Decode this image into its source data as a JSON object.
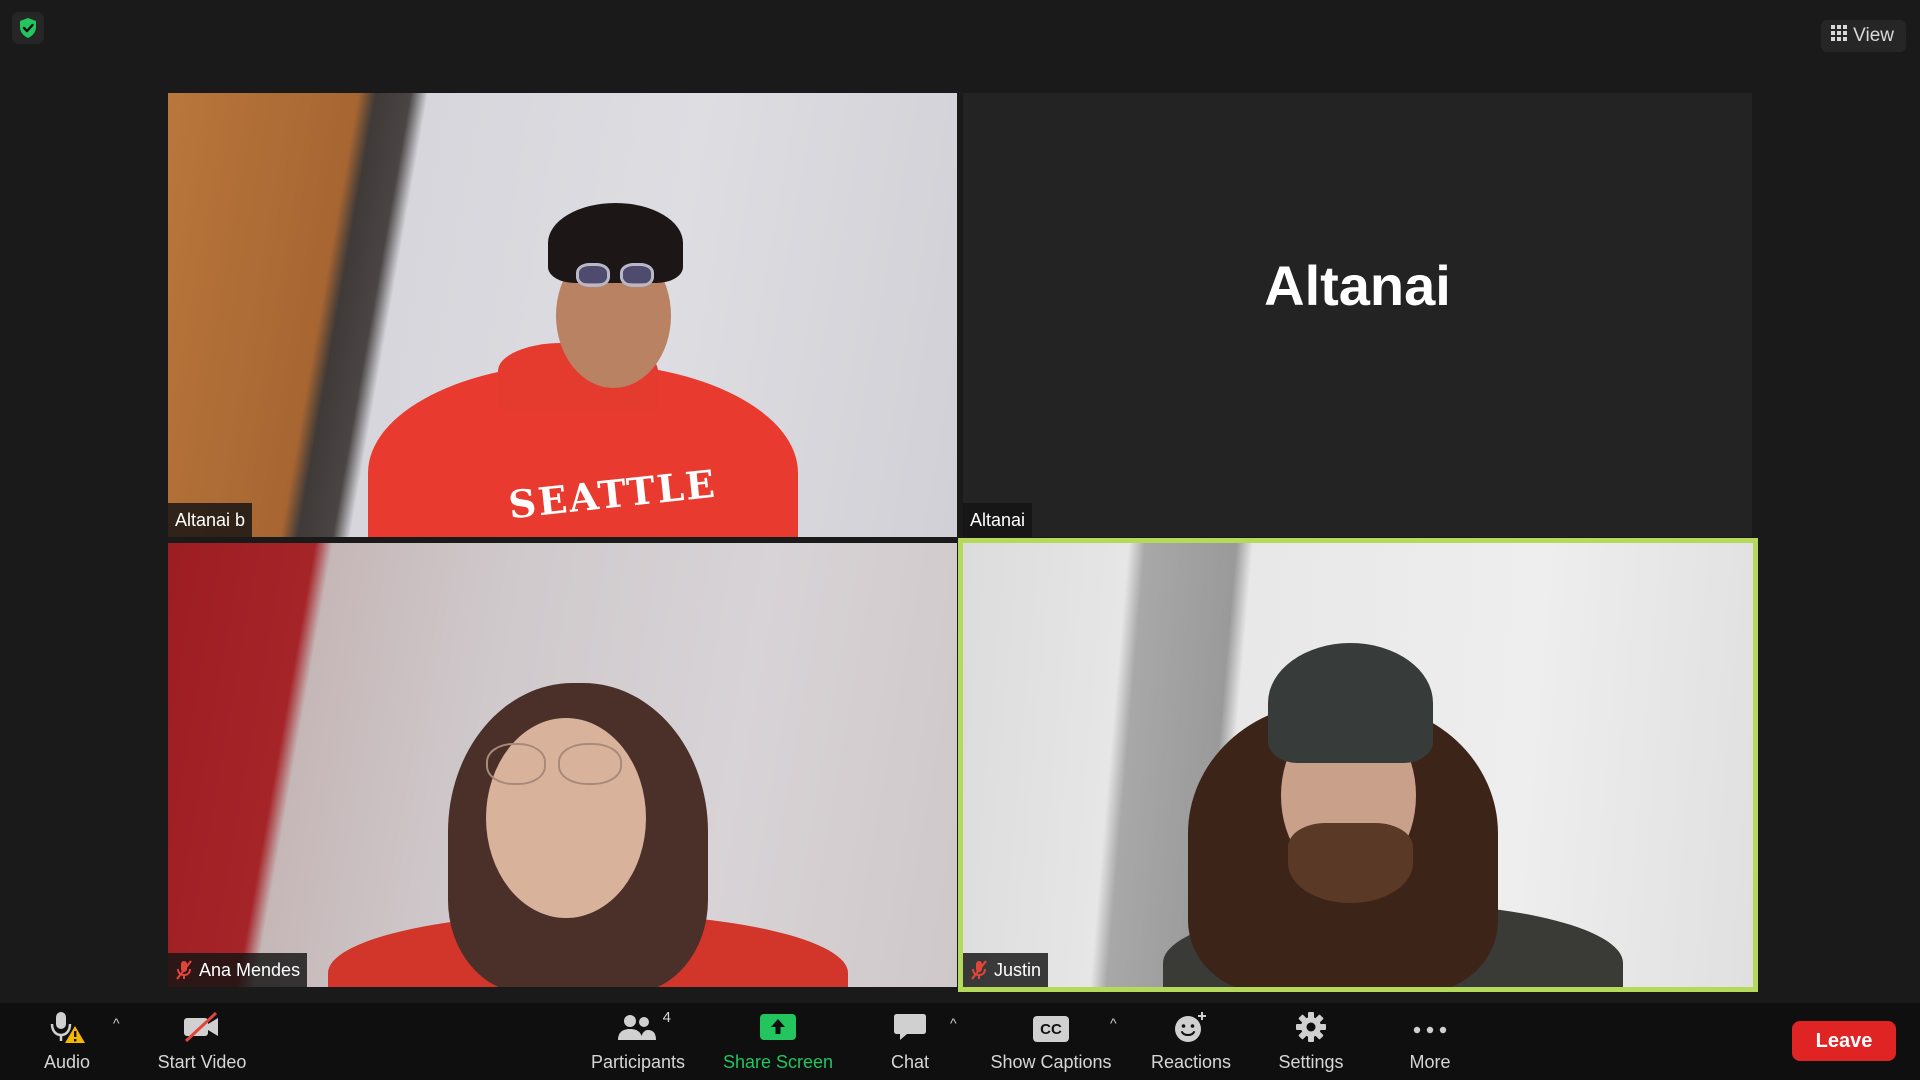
{
  "header": {
    "view_label": "View",
    "icons": {
      "security": "shield-check-icon",
      "view": "grid-icon"
    }
  },
  "participants": [
    {
      "name": "Altanai b",
      "video": "on",
      "muted": false
    },
    {
      "name": "Altanai",
      "video": "off",
      "display_name": "Altanai",
      "muted": false
    },
    {
      "name": "Ana Mendes",
      "video": "on",
      "muted": true
    },
    {
      "name": "Justin",
      "video": "on",
      "muted": true,
      "active_speaker": true
    }
  ],
  "toolbar": {
    "audio_label": "Audio",
    "start_video_label": "Start Video",
    "participants_label": "Participants",
    "participants_count": "4",
    "share_screen_label": "Share Screen",
    "chat_label": "Chat",
    "show_captions_label": "Show Captions",
    "captions_icon_text": "CC",
    "reactions_label": "Reactions",
    "settings_label": "Settings",
    "more_label": "More",
    "leave_label": "Leave",
    "caret": "^"
  },
  "colors": {
    "accent_green": "#22c55e",
    "active_speaker_border": "#b5d95a",
    "leave_red": "#e02424",
    "mute_red": "#e0453a",
    "warning_yellow": "#f5b800"
  }
}
